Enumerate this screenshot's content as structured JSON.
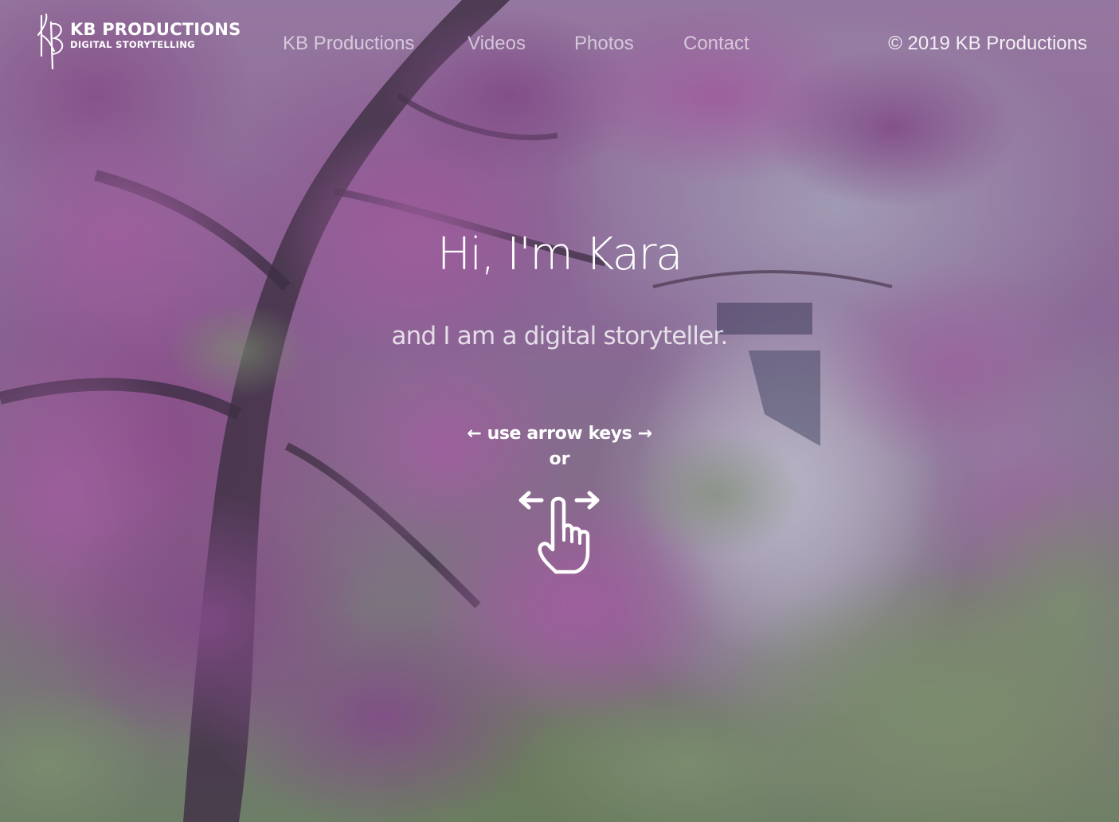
{
  "brand": {
    "logo_title": "KB PRODUCTIONS",
    "logo_subtitle": "DIGITAL STORYTELLING",
    "logo_mark_icon": "kb-monogram-icon"
  },
  "nav": {
    "items": [
      {
        "label": "KB Productions"
      },
      {
        "label": "Videos"
      },
      {
        "label": "Photos"
      },
      {
        "label": "Contact"
      }
    ],
    "copyright": "© 2019 KB Productions"
  },
  "hero": {
    "title": "Hi, I'm Kara",
    "subtitle": "and I am a digital storyteller.",
    "hint_keys": "← use arrow keys →",
    "hint_or": "or",
    "swipe_icon": "swipe-gesture-icon"
  },
  "colors": {
    "text": "#ffffff",
    "overlay": "#46446e",
    "blossom": "#b25aa0",
    "foliage": "#7e9a63"
  }
}
